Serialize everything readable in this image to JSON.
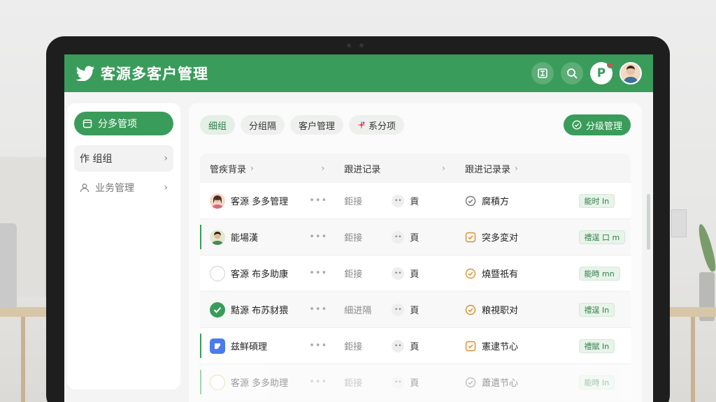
{
  "app": {
    "title": "客源多客户管理",
    "brand_color": "#3a9c5a"
  },
  "header": {
    "icons": [
      "bookmark-icon",
      "search-icon",
      "p-icon",
      "avatar"
    ],
    "p_label": "P"
  },
  "sidebar": {
    "primary_label": "分多管项",
    "items": [
      {
        "label": "作 组组",
        "icon": "menu-icon"
      },
      {
        "label": "业务管理",
        "icon": "user-icon"
      }
    ]
  },
  "main": {
    "tabs": [
      {
        "label": "细组",
        "active": true
      },
      {
        "label": "分组隔"
      },
      {
        "label": "客户管理"
      },
      {
        "label": "系分项"
      }
    ],
    "action_label": "分级管理",
    "columns": [
      "管疾背录",
      "跟进记录",
      "跟进记录录"
    ],
    "rows": [
      {
        "name": "客源 多多管理",
        "stage": "鉅接",
        "page": "貢",
        "record": "腐積方",
        "record_icon": "check-circle-gray",
        "badge": "能时 In",
        "avatar": "woman"
      },
      {
        "name": "能場漢",
        "stage": "鉅接",
        "page": "頁",
        "record": "突多変对",
        "record_icon": "check-square-orange",
        "badge": "禮逞 口 m",
        "avatar": "man"
      },
      {
        "name": "客源 布多助康",
        "stage": "鉅接",
        "page": "頁",
        "record": "燒暨祇有",
        "record_icon": "check-circle-orange",
        "badge": "能時 mn",
        "avatar": "empty"
      },
      {
        "name": "黠源 布苏豺猥",
        "stage": "細进隔",
        "page": "頁",
        "record": "粮視职对",
        "record_icon": "check-circle-orange",
        "badge": "禮逞 In",
        "avatar": "check"
      },
      {
        "name": "兹鲜碩理",
        "stage": "鉅接",
        "page": "頁",
        "record": "憲逮节心",
        "record_icon": "check-square-orange",
        "badge": "禮賦 In",
        "avatar": "logo"
      },
      {
        "name": "客源 多多助理",
        "stage": "鉅接",
        "page": "頁",
        "record": "蕭遺节心",
        "record_icon": "check-circle-gray",
        "badge": "能時 In",
        "avatar": "empty-yellow"
      }
    ]
  }
}
